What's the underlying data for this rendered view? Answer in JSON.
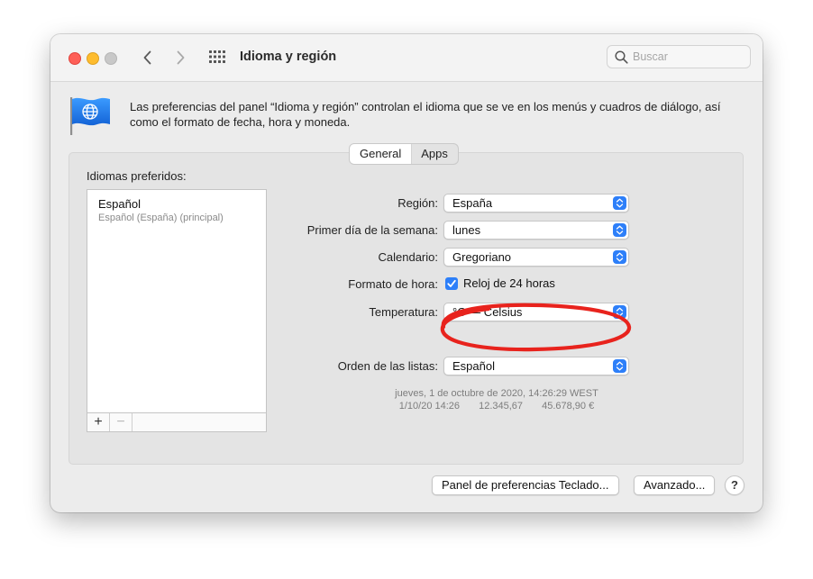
{
  "window": {
    "title": "Idioma y región"
  },
  "search": {
    "placeholder": "Buscar"
  },
  "description": "Las preferencias del panel “Idioma y región” controlan el idioma que se ve en los menús y cuadros de diálogo, así como el formato de fecha, hora y moneda.",
  "tabs": [
    {
      "label": "General",
      "selected": true
    },
    {
      "label": "Apps",
      "selected": false
    }
  ],
  "preferred_languages": {
    "label": "Idiomas preferidos:",
    "items": [
      {
        "name": "Español",
        "detail": "Español (España) (principal)"
      }
    ],
    "add_label": "+",
    "remove_label": "−"
  },
  "settings": {
    "region": {
      "label": "Región:",
      "value": "España"
    },
    "first_day": {
      "label": "Primer día de la semana:",
      "value": "lunes"
    },
    "calendar": {
      "label": "Calendario:",
      "value": "Gregoriano"
    },
    "time_format": {
      "label": "Formato de hora:",
      "checkbox_label": "Reloj de 24 horas",
      "checked": true
    },
    "temperature": {
      "label": "Temperatura:",
      "value": "°C — Celsius"
    },
    "list_order": {
      "label": "Orden de las listas:",
      "value": "Español"
    }
  },
  "example": {
    "long_date": "jueves, 1 de octubre de 2020, 14:26:29 WEST",
    "short_date": "1/10/20 14:26",
    "number": "12.345,67",
    "currency": "45.678,90 €"
  },
  "buttons": {
    "keyboard_prefs": "Panel de preferencias Teclado...",
    "advanced": "Avanzado...",
    "help": "?"
  },
  "icons": {
    "back": "chevron-left-icon",
    "forward": "chevron-right-icon",
    "show_all": "grid-icon",
    "search": "magnifier-icon",
    "panel": "blue-flag-globe-icon"
  },
  "colors": {
    "accent": "#2d7ff9",
    "close": "#fe5f57",
    "minimize": "#febc2e",
    "zoom_disabled": "#c8c8c8",
    "annotation": "#e8231d"
  }
}
